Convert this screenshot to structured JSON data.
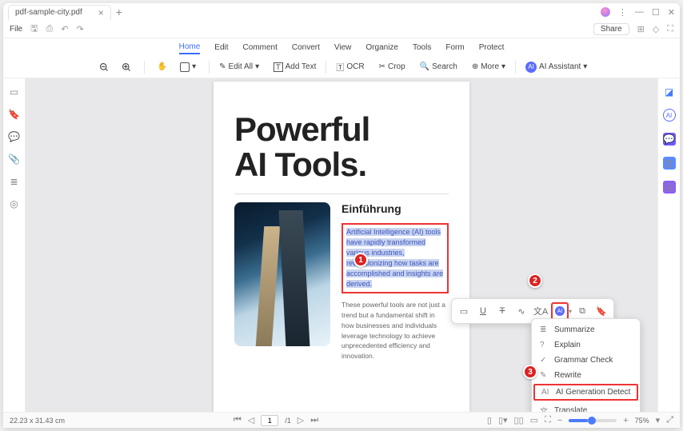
{
  "titlebar": {
    "tab": "pdf-sample-city.pdf"
  },
  "file_menu": {
    "label": "File"
  },
  "menu": [
    "Home",
    "Edit",
    "Comment",
    "Convert",
    "View",
    "Organize",
    "Tools",
    "Form",
    "Protect"
  ],
  "menu_active": 0,
  "share": "Share",
  "toolbar": {
    "edit_all": "Edit All",
    "add_text": "Add Text",
    "ocr": "OCR",
    "crop": "Crop",
    "search": "Search",
    "more": "More",
    "ai_assistant": "AI Assistant"
  },
  "page": {
    "title_l1": "Powerful",
    "title_l2": "AI Tools.",
    "heading": "Einführung",
    "selected": "Artificial Intelligence (AI) tools have rapidly transformed various industries, revolutionizing how tasks are accomplished and insights are derived.",
    "body": "These powerful tools are not just a trend but a fundamental shift in how businesses and individuals leverage technology to achieve unprecedented efficiency and innovation."
  },
  "ai_menu": {
    "summarize": "Summarize",
    "explain": "Explain",
    "grammar": "Grammar Check",
    "rewrite": "Rewrite",
    "detect": "AI Generation Detect",
    "translate": "Translate"
  },
  "callouts": {
    "one": "1",
    "two": "2",
    "three": "3"
  },
  "status": {
    "dims": "22.23 x 31.43 cm",
    "page": "1",
    "total": "/1",
    "zoom": "75%"
  }
}
